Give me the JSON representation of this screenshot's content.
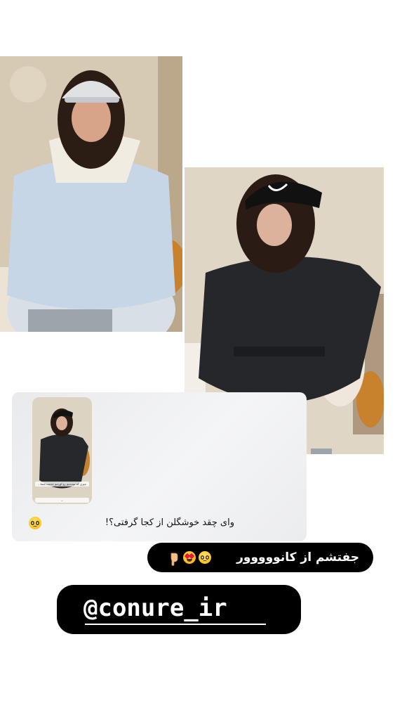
{
  "photos": [
    {
      "subject": "woman in light blue puffer jacket and white cap"
    },
    {
      "subject": "woman in black belted double-breasted coat and black cap"
    }
  ],
  "reply": {
    "thumb_caption": "چیزی که میدیدیم رو اوردیم خدمت شما...",
    "thumb_caption_2": "...",
    "comment_text": "وای چقد خوشگلن از کجا گرفتی؟!"
  },
  "answer": {
    "text": "جفتشم از کانووووور"
  },
  "handle": {
    "text": "@conure_ir"
  },
  "icons": {
    "reply_emoji": "pleading-face",
    "answer_emojis": [
      "pleading-face",
      "heart-eyes-face",
      "hand-pointing-down"
    ]
  },
  "colors": {
    "pill_background": "#000000",
    "pill_text": "#ffffff",
    "card_background": "#eeeff1"
  }
}
